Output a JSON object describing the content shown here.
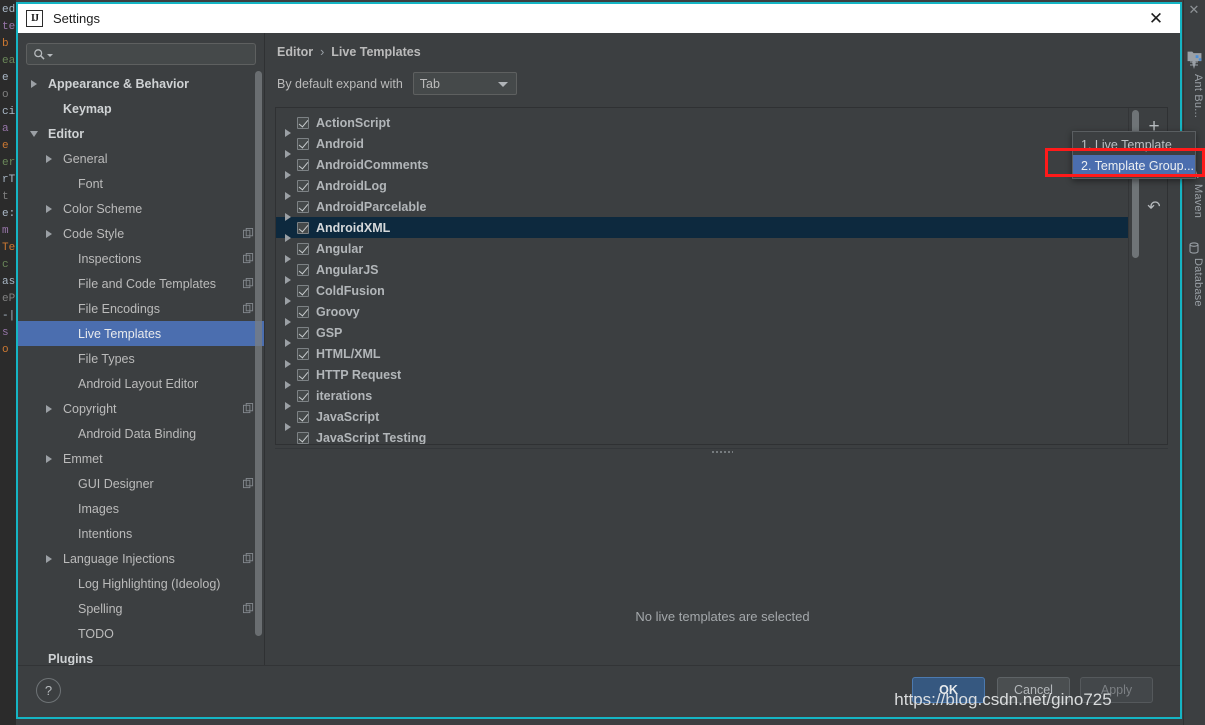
{
  "window": {
    "title": "Settings",
    "app_icon": "intellij-idea-icon",
    "close_label": "✕"
  },
  "search": {
    "placeholder": "",
    "value": "",
    "icon": "search-icon"
  },
  "sidebar": {
    "items": [
      {
        "label": "Appearance & Behavior",
        "indent": 0,
        "arrow": "closed",
        "bold": true,
        "badge": false,
        "selected": false
      },
      {
        "label": "Keymap",
        "indent": 1,
        "arrow": "none",
        "bold": true,
        "badge": false,
        "selected": false
      },
      {
        "label": "Editor",
        "indent": 0,
        "arrow": "open",
        "bold": true,
        "badge": false,
        "selected": false
      },
      {
        "label": "General",
        "indent": 1,
        "arrow": "closed",
        "bold": false,
        "badge": false,
        "selected": false
      },
      {
        "label": "Font",
        "indent": 2,
        "arrow": "none",
        "bold": false,
        "badge": false,
        "selected": false
      },
      {
        "label": "Color Scheme",
        "indent": 1,
        "arrow": "closed",
        "bold": false,
        "badge": false,
        "selected": false
      },
      {
        "label": "Code Style",
        "indent": 1,
        "arrow": "closed",
        "bold": false,
        "badge": true,
        "selected": false
      },
      {
        "label": "Inspections",
        "indent": 2,
        "arrow": "none",
        "bold": false,
        "badge": true,
        "selected": false
      },
      {
        "label": "File and Code Templates",
        "indent": 2,
        "arrow": "none",
        "bold": false,
        "badge": true,
        "selected": false
      },
      {
        "label": "File Encodings",
        "indent": 2,
        "arrow": "none",
        "bold": false,
        "badge": true,
        "selected": false
      },
      {
        "label": "Live Templates",
        "indent": 2,
        "arrow": "none",
        "bold": false,
        "badge": false,
        "selected": true
      },
      {
        "label": "File Types",
        "indent": 2,
        "arrow": "none",
        "bold": false,
        "badge": false,
        "selected": false
      },
      {
        "label": "Android Layout Editor",
        "indent": 2,
        "arrow": "none",
        "bold": false,
        "badge": false,
        "selected": false
      },
      {
        "label": "Copyright",
        "indent": 1,
        "arrow": "closed",
        "bold": false,
        "badge": true,
        "selected": false
      },
      {
        "label": "Android Data Binding",
        "indent": 2,
        "arrow": "none",
        "bold": false,
        "badge": false,
        "selected": false
      },
      {
        "label": "Emmet",
        "indent": 1,
        "arrow": "closed",
        "bold": false,
        "badge": false,
        "selected": false
      },
      {
        "label": "GUI Designer",
        "indent": 2,
        "arrow": "none",
        "bold": false,
        "badge": true,
        "selected": false
      },
      {
        "label": "Images",
        "indent": 2,
        "arrow": "none",
        "bold": false,
        "badge": false,
        "selected": false
      },
      {
        "label": "Intentions",
        "indent": 2,
        "arrow": "none",
        "bold": false,
        "badge": false,
        "selected": false
      },
      {
        "label": "Language Injections",
        "indent": 1,
        "arrow": "closed",
        "bold": false,
        "badge": true,
        "selected": false
      },
      {
        "label": "Log Highlighting (Ideolog)",
        "indent": 2,
        "arrow": "none",
        "bold": false,
        "badge": false,
        "selected": false
      },
      {
        "label": "Spelling",
        "indent": 2,
        "arrow": "none",
        "bold": false,
        "badge": true,
        "selected": false
      },
      {
        "label": "TODO",
        "indent": 2,
        "arrow": "none",
        "bold": false,
        "badge": false,
        "selected": false
      },
      {
        "label": "Plugins",
        "indent": 0,
        "arrow": "none",
        "bold": true,
        "badge": false,
        "selected": false
      }
    ]
  },
  "content": {
    "breadcrumb": {
      "parent": "Editor",
      "separator": "›",
      "current": "Live Templates"
    },
    "expand": {
      "label": "By default expand with",
      "value": "Tab"
    },
    "empty_message": "No live templates are selected",
    "toolbar": {
      "add_label": "+",
      "add_icon": "plus-icon",
      "revert_icon": "revert-arrow-icon",
      "revert_label": "↶"
    },
    "templates": [
      {
        "name": "ActionScript",
        "checked": true,
        "selected": false
      },
      {
        "name": "Android",
        "checked": true,
        "selected": false
      },
      {
        "name": "AndroidComments",
        "checked": true,
        "selected": false
      },
      {
        "name": "AndroidLog",
        "checked": true,
        "selected": false
      },
      {
        "name": "AndroidParcelable",
        "checked": true,
        "selected": false
      },
      {
        "name": "AndroidXML",
        "checked": true,
        "selected": true
      },
      {
        "name": "Angular",
        "checked": true,
        "selected": false
      },
      {
        "name": "AngularJS",
        "checked": true,
        "selected": false
      },
      {
        "name": "ColdFusion",
        "checked": true,
        "selected": false
      },
      {
        "name": "Groovy",
        "checked": true,
        "selected": false
      },
      {
        "name": "GSP",
        "checked": true,
        "selected": false
      },
      {
        "name": "HTML/XML",
        "checked": true,
        "selected": false
      },
      {
        "name": "HTTP Request",
        "checked": true,
        "selected": false
      },
      {
        "name": "iterations",
        "checked": true,
        "selected": false
      },
      {
        "name": "JavaScript",
        "checked": true,
        "selected": false
      },
      {
        "name": "JavaScript Testing",
        "checked": true,
        "selected": false
      }
    ]
  },
  "popup": {
    "items": [
      {
        "label": "1. Live Template",
        "active": false
      },
      {
        "label": "2. Template Group...",
        "active": true
      }
    ]
  },
  "footer": {
    "help_label": "?",
    "ok_label": "OK",
    "cancel_label": "Cancel",
    "apply_label": "Apply"
  },
  "ide": {
    "right_tabs": [
      {
        "label": "Ant Bu...",
        "icon": "ant-icon"
      },
      {
        "label": "Maven",
        "icon": "maven-icon"
      },
      {
        "label": "Database",
        "icon": "database-icon"
      }
    ],
    "right_icons": [
      {
        "name": "search-icon",
        "glyph": "⚲"
      },
      {
        "name": "project-icon",
        "glyph": "■"
      },
      {
        "name": "minimize-icon",
        "glyph": "—"
      },
      {
        "name": "expand-icon",
        "glyph": "»"
      }
    ],
    "close_label": "✕",
    "left_code_fragments": [
      "ed",
      "te",
      "b",
      "ea",
      "e",
      "o",
      "ci",
      "a",
      "e",
      "er",
      "rT",
      "t",
      "e:",
      "m",
      "Te",
      "c",
      "as",
      "eP",
      "-|",
      "s",
      "o"
    ]
  },
  "colors": {
    "accent_cyan": "#15b5c4",
    "selection_blue": "#4b6eaf",
    "list_selection": "#0d293e",
    "annotation_red": "#ff1a1a",
    "ok_button": "#365880",
    "background": "#3c3f41"
  },
  "watermark": {
    "text": "https://blog.csdn.net/gino725"
  }
}
